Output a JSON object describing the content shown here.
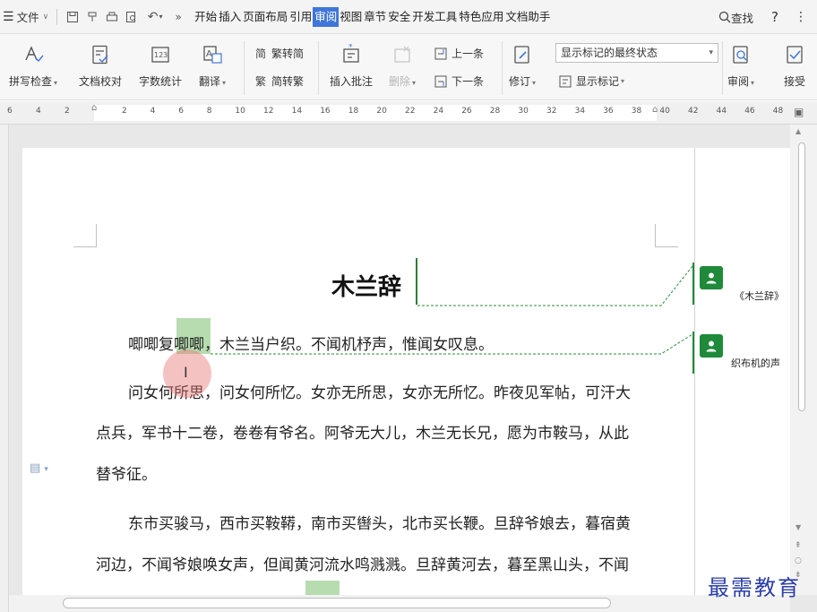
{
  "menubar": {
    "file": "文件",
    "tabs": [
      "开始",
      "插入",
      "页面布局",
      "引用",
      "审阅",
      "视图",
      "章节",
      "安全",
      "开发工具",
      "特色应用",
      "文档助手"
    ],
    "active_tab": "审阅",
    "search": "查找",
    "help": "?",
    "more": "⋮"
  },
  "ribbon": {
    "spell_check": "拼写检查",
    "doc_proof": "文档校对",
    "word_count": "字数统计",
    "translate": "翻译",
    "to_traditional": "繁转简",
    "to_simplified": "简转繁",
    "insert_comment": "插入批注",
    "delete": "删除",
    "prev": "上一条",
    "next": "下一条",
    "track": "修订",
    "display_mode": "显示标记的最终状态",
    "show_markup": "显示标记",
    "review": "审阅",
    "accept": "接受"
  },
  "ruler": {
    "left_numbers": [
      "6",
      "4",
      "2"
    ],
    "numbers": [
      "2",
      "4",
      "6",
      "8",
      "10",
      "12",
      "14",
      "16",
      "18",
      "20",
      "22",
      "24",
      "26",
      "28",
      "30",
      "32",
      "34",
      "36",
      "38",
      "40",
      "42",
      "44",
      "46",
      "48"
    ]
  },
  "document": {
    "title": "木兰辞",
    "p1": "唧唧复唧唧，木兰当户织。不闻机杼声，惟闻女叹息。",
    "p2_l1": "问女何所思，问女何所忆。女亦无所思，女亦无所忆。昨夜见军帖，可汗大",
    "p2_l2": "点兵，军书十二卷，卷卷有爷名。阿爷无大儿，木兰无长兄，愿为市鞍马，从此",
    "p2_l3": "替爷征。",
    "p3_l1": "东市买骏马，西市买鞍鞯，南市买辔头，北市买长鞭。旦辞爷娘去，暮宿黄",
    "p3_l2": "河边，不闻爷娘唤女声，但闻黄河流水鸣溅溅。旦辞黄河去，暮至黑山头，不闻"
  },
  "comments": [
    {
      "text": "《木兰辞》"
    },
    {
      "text": "织布机的声"
    }
  ],
  "watermark": "最需教育",
  "colors": {
    "accent": "#3f76d8",
    "comment": "#1e8a3a",
    "highlight": "#b6dcb0"
  }
}
